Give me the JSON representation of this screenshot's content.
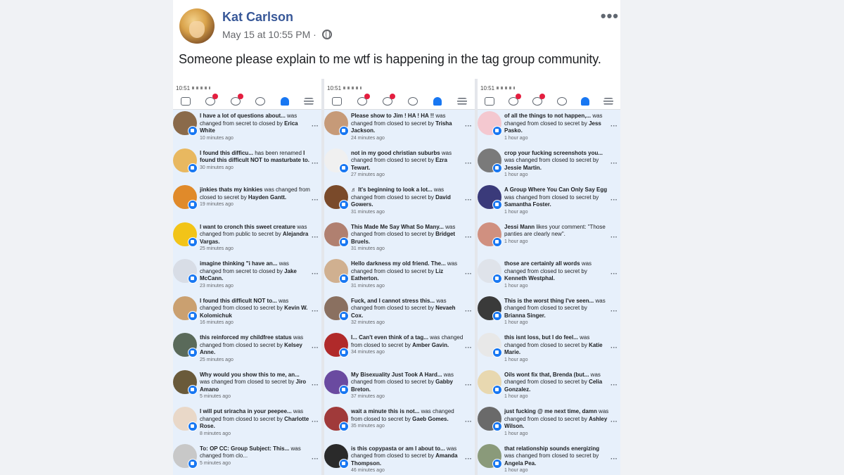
{
  "post": {
    "author": "Kat Carlson",
    "timestamp": "May 15 at 10:55 PM · ",
    "privacy_icon": "globe-icon",
    "text": "Someone please explain to me wtf is happening in the tag group community.",
    "more_label": "•••"
  },
  "colors": {
    "accent": "#1877f2",
    "author": "#385898",
    "unread_bg": "#e7f0fb"
  },
  "phones": [
    {
      "status_time": "10:51",
      "items": [
        {
          "title": "I have a lot of questions about...",
          "mid": " was changed from secret to closed by ",
          "actor": "Erica White",
          "time": "10 minutes ago",
          "thumb": "#8a6a4a"
        },
        {
          "title": "I found this difficu...",
          "mid": " has been renamed ",
          "actor": "I found this difficult NOT to masturbate to.",
          "time": "30 minutes ago",
          "thumb": "#e8b860"
        },
        {
          "title": "jinkies thats my kinkies",
          "mid": " was changed from closed to secret by ",
          "actor": "Hayden Gantt.",
          "time": "19 minutes ago",
          "thumb": "#e08a2a"
        },
        {
          "title": "I want to cronch this sweet creature",
          "mid": " was changed from public to secret by ",
          "actor": "Alejandra Vargas.",
          "time": "25 minutes ago",
          "thumb": "#f2c418"
        },
        {
          "title": "imagine thinking \"i have an...",
          "mid": " was changed from secret to closed by ",
          "actor": "Jake McCann.",
          "time": "23 minutes ago",
          "thumb": "#d8dde6"
        },
        {
          "title": "I found this difficult NOT to...",
          "mid": " was changed from closed to secret by ",
          "actor": "Kevin W. Kolomichuk",
          "time": "16 minutes ago",
          "thumb": "#caa070"
        },
        {
          "title": "this reinforced my childfree status",
          "mid": " was changed from closed to secret by ",
          "actor": "Kelsey Anne.",
          "time": "25 minutes ago",
          "thumb": "#5a6a5a"
        },
        {
          "title": "Why would you show this to me, an...",
          "mid": " was changed from closed to secret by ",
          "actor": "Jiro Amano",
          "time": "5 minutes ago",
          "thumb": "#6a5a3a"
        },
        {
          "title": "I will put sriracha in your peepee...",
          "mid": " was changed from closed to secret by ",
          "actor": "Charlotte Rose.",
          "time": "8 minutes ago",
          "thumb": "#e9d8c8"
        },
        {
          "title": "To: OP CC: Group Subject: This...",
          "mid": " was changed from clo...",
          "actor": "",
          "time": "5 minutes ago",
          "thumb": "#c8c8c8"
        }
      ]
    },
    {
      "status_time": "10:51",
      "items": [
        {
          "title": "Please show to Jim ! HA ! HA !!",
          "mid": " was changed from closed to secret by ",
          "actor": "Trisha Jackson.",
          "time": "24 minutes ago",
          "thumb": "#c69a78"
        },
        {
          "title": "not in my good christian suburbs",
          "mid": " was changed from closed to secret by ",
          "actor": "Ezra Tewart.",
          "time": "27 minutes ago",
          "thumb": "#f0f0f0"
        },
        {
          "title": "♬ It's beginning to look a lot...",
          "mid": " was changed from closed to secret by ",
          "actor": "David Gowers.",
          "time": "31 minutes ago",
          "thumb": "#7a4a2a"
        },
        {
          "title": "This Made Me Say What So Many...",
          "mid": " was changed from closed to secret by ",
          "actor": "Bridget Bruels.",
          "time": "31 minutes ago",
          "thumb": "#b08070"
        },
        {
          "title": "Hello darkness my old friend. The...",
          "mid": " was changed from closed to secret by ",
          "actor": "Liz Eatherton.",
          "time": "31 minutes ago",
          "thumb": "#d0b090"
        },
        {
          "title": "Fuck, and I cannot stress this...",
          "mid": " was changed from closed to secret by ",
          "actor": "Nevaeh Cox.",
          "time": "32 minutes ago",
          "thumb": "#8a7060"
        },
        {
          "title": "I... Can't even think of a tag...",
          "mid": " was changed from closed to secret by ",
          "actor": "Amber Gavin.",
          "time": "34 minutes ago",
          "thumb": "#b02a2a"
        },
        {
          "title": "My Bisexuality Just Took A Hard...",
          "mid": " was changed from closed to secret by ",
          "actor": "Gabby Breton.",
          "time": "37 minutes ago",
          "thumb": "#6a4aa0"
        },
        {
          "title": "wait a minute this is not...",
          "mid": " was changed from closed to secret by ",
          "actor": "Gaeb Gomes.",
          "time": "35 minutes ago",
          "thumb": "#a03a3a"
        },
        {
          "title": "is this copypasta or am I about to...",
          "mid": " was changed from closed to secret by ",
          "actor": "Amanda Thompson.",
          "time": "46 minutes ago",
          "thumb": "#2a2a2a"
        }
      ]
    },
    {
      "status_time": "10:51",
      "items": [
        {
          "title": "of all the things to not happen,...",
          "mid": " was changed from closed to secret by ",
          "actor": "Jess Pasko.",
          "time": "1 hour ago",
          "thumb": "#f4c8d0"
        },
        {
          "title": "crop your fucking screenshots you...",
          "mid": " was changed from closed to secret by ",
          "actor": "Jessie Martin.",
          "time": "1 hour ago",
          "thumb": "#7a7a7a"
        },
        {
          "title": "A Group Where You Can Only Say Egg",
          "mid": " was changed from closed to secret by ",
          "actor": "Samantha Foster.",
          "time": "1 hour ago",
          "thumb": "#3a3a7a"
        },
        {
          "title": "Jessi Mann",
          "mid": " likes your comment: \"Those panties are clearly new\".",
          "actor": "",
          "time": "1 hour ago",
          "thumb": "#d09080"
        },
        {
          "title": "those are certainly all words",
          "mid": " was changed from closed to secret by ",
          "actor": "Kenneth Westphal.",
          "time": "1 hour ago",
          "thumb": "#dfe3ea"
        },
        {
          "title": "This is the worst thing I've seen...",
          "mid": " was changed from closed to secret by ",
          "actor": "Brianna Singer.",
          "time": "1 hour ago",
          "thumb": "#3a3a3a"
        },
        {
          "title": "this isnt loss, but I do feel...",
          "mid": " was changed from closed to secret by ",
          "actor": "Katie Marie.",
          "time": "1 hour ago",
          "thumb": "#e8e8e8"
        },
        {
          "title": "Oils wont fix that, Brenda (but...",
          "mid": " was changed from closed to secret by ",
          "actor": "Celia Gonzalez.",
          "time": "1 hour ago",
          "thumb": "#e8d8b0"
        },
        {
          "title": "just fucking @ me next time, damn",
          "mid": " was changed from closed to secret by ",
          "actor": "Ashley Wilson.",
          "time": "1 hour ago",
          "thumb": "#6a6a6a"
        },
        {
          "title": "that relationship sounds energizing",
          "mid": " was changed from closed to secret by ",
          "actor": "Angela Pea.",
          "time": "1 hour ago",
          "thumb": "#8a9a7a"
        }
      ]
    }
  ]
}
